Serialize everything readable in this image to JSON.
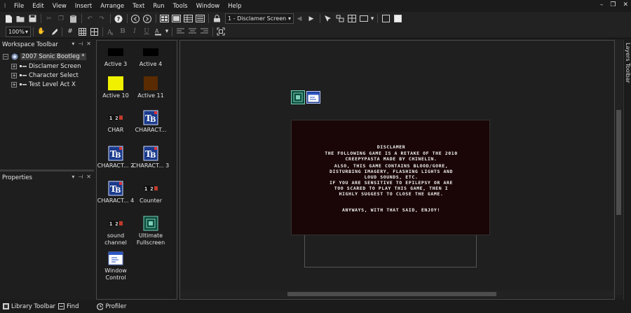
{
  "menu": {
    "items": [
      "File",
      "Edit",
      "View",
      "Insert",
      "Arrange",
      "Text",
      "Run",
      "Tools",
      "Window",
      "Help"
    ]
  },
  "window_controls": {
    "minimize": "–",
    "restore": "❐",
    "close": "✕"
  },
  "toolbar": {
    "frame_select": "1 - Disclamer Screen",
    "zoom": "100%",
    "bold": "B",
    "italic": "I",
    "underline": "U"
  },
  "workspace": {
    "title": "Workspace Toolbar",
    "root": "2007 Sonic Bootleg *",
    "frames": [
      "Disclamer Screen",
      "Character Select",
      "Test Level Act X"
    ]
  },
  "properties": {
    "title": "Properties"
  },
  "panel_controls": {
    "dropdown": "▾",
    "pin": "⊣",
    "close": "✕"
  },
  "library": {
    "items": [
      {
        "label": "Active 3",
        "icon": "black-square-icon"
      },
      {
        "label": "Active 4",
        "icon": "black-square-icon"
      },
      {
        "label": "Active 10",
        "icon": "yellow-square-icon"
      },
      {
        "label": "Active 11",
        "icon": "brown-square-icon"
      },
      {
        "label": "CHAR",
        "icon": "counter-icon"
      },
      {
        "label": "CHARACT...",
        "icon": "text-blitter-icon"
      },
      {
        "label": "CHARACT... 2",
        "icon": "text-blitter-icon"
      },
      {
        "label": "CHARACT... 3",
        "icon": "text-blitter-icon"
      },
      {
        "label": "CHARACT... 4",
        "icon": "text-blitter-icon"
      },
      {
        "label": "Counter",
        "icon": "counter-icon"
      },
      {
        "label": "sound channel",
        "icon": "counter-icon"
      },
      {
        "label": "Ultimate Fullscreen",
        "icon": "fullscreen-icon"
      },
      {
        "label": "Window Control",
        "icon": "window-control-icon"
      }
    ],
    "counter_glyph": "1 2"
  },
  "screen": {
    "title": "DISCLAMER",
    "lines": [
      "THE FOLLOWING GAME IS A RETAKE OF THE 2010",
      "CREEPYPASTA MADE BY CHINELIN.",
      "ALSO, THIS GAME CONTAINS BLOOD/GORE,",
      "DISTURBING IMAGERY, FLASHING LIGHTS AND",
      "LOUD SOUNDS, ETC.",
      "IF YOU ARE SENSITIVE TO EPILEPSY OR ARE",
      "TOO SCARED TO PLAY THIS GAME, THEN I",
      "HIGHLY SUGGEST TO CLOSE THE GAME.",
      "ANYWAYS, WITH THAT SAID, ENJOY!"
    ]
  },
  "layers_tab": "Layers Toolbar",
  "status": {
    "library_toolbar": "Library Toolbar",
    "find": "Find",
    "profiler": "Profiler"
  },
  "colors": {
    "active3": "#000000",
    "active4": "#000000",
    "active10": "#f0f000",
    "active11": "#5a2a00",
    "screen_bg": "#1a0606",
    "tb_blue": "#1a3a8c"
  }
}
